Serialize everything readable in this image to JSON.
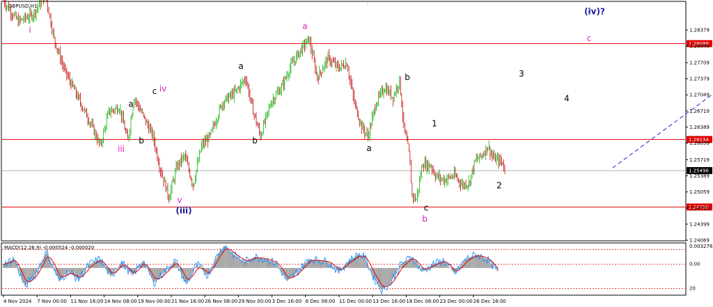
{
  "chart_data": {
    "type": "candlestick",
    "symbol_label": "GBPUSD,H1",
    "colors": {
      "bull": "#00b000",
      "bear": "#c00000",
      "hline": "#e00000",
      "wave_dark": "#000000",
      "wave_pink": "#e020c0",
      "wave_blue": "#1a1a9a",
      "macd_hist": "#a8a8a8",
      "macd_signal": "#e00000",
      "macd_line": "#1e90ff",
      "current_line": "#b0b0b0",
      "projection": "#2020d0"
    },
    "price_axis": {
      "min": 1.2407,
      "max": 1.2895,
      "ticks": [
        "1.28379",
        "1.28049",
        "1.27709",
        "1.27379",
        "1.27049",
        "1.26719",
        "1.26389",
        "1.26059",
        "1.25719",
        "1.25389",
        "1.25059",
        "1.24729",
        "1.24399",
        "1.24069"
      ]
    },
    "time_axis": {
      "bars": 380,
      "labels": [
        {
          "text": "4 Nov 2024",
          "bar": 0
        },
        {
          "text": "7 Nov 00:00",
          "bar": 29
        },
        {
          "text": "11 Nov 16:00",
          "bar": 57
        },
        {
          "text": "14 Nov 08:00",
          "bar": 86
        },
        {
          "text": "19 Nov 00:00",
          "bar": 115
        },
        {
          "text": "21 Nov 16:00",
          "bar": 143
        },
        {
          "text": "26 Nov 08:00",
          "bar": 172
        },
        {
          "text": "29 Nov 00:00",
          "bar": 201
        },
        {
          "text": "3 Dec 16:00",
          "bar": 229
        },
        {
          "text": "6 Dec 08:00",
          "bar": 258
        },
        {
          "text": "11 Dec 00:00",
          "bar": 287
        },
        {
          "text": "13 Dec 16:00",
          "bar": 315
        },
        {
          "text": "18 Dec 08:00",
          "bar": 344
        },
        {
          "text": "23 Dec 00:00",
          "bar": 373
        },
        {
          "text": "26 Dec 16:00",
          "bar": 401
        }
      ]
    },
    "horizontal_lines": [
      {
        "price": 1.28099,
        "label": "1.28099"
      },
      {
        "price": 1.26134,
        "label": "1.26134"
      },
      {
        "price": 1.2475,
        "label": "1.24750"
      }
    ],
    "current_price": {
      "price": 1.25496,
      "label": "1.25496"
    },
    "price_path": [
      [
        0,
        1.2897
      ],
      [
        14,
        1.2855
      ],
      [
        28,
        1.287
      ],
      [
        40,
        1.291
      ],
      [
        48,
        1.282
      ],
      [
        58,
        1.2755
      ],
      [
        66,
        1.272
      ],
      [
        75,
        1.268
      ],
      [
        82,
        1.265
      ],
      [
        92,
        1.26
      ],
      [
        100,
        1.267
      ],
      [
        110,
        1.268
      ],
      [
        118,
        1.261
      ],
      [
        124,
        1.27
      ],
      [
        133,
        1.266
      ],
      [
        142,
        1.262
      ],
      [
        148,
        1.256
      ],
      [
        157,
        1.2495
      ],
      [
        165,
        1.256
      ],
      [
        172,
        1.258
      ],
      [
        180,
        1.252
      ],
      [
        188,
        1.26
      ],
      [
        196,
        1.262
      ],
      [
        208,
        1.269
      ],
      [
        220,
        1.271
      ],
      [
        230,
        1.274
      ],
      [
        236,
        1.268
      ],
      [
        244,
        1.262
      ],
      [
        254,
        1.269
      ],
      [
        264,
        1.272
      ],
      [
        272,
        1.276
      ],
      [
        280,
        1.279
      ],
      [
        290,
        1.282
      ],
      [
        298,
        1.274
      ],
      [
        308,
        1.278
      ],
      [
        318,
        1.276
      ],
      [
        326,
        1.277
      ],
      [
        333,
        1.269
      ],
      [
        340,
        1.264
      ],
      [
        346,
        1.262
      ],
      [
        354,
        1.269
      ],
      [
        362,
        1.272
      ],
      [
        370,
        1.27
      ],
      [
        376,
        1.2735
      ],
      [
        380,
        1.264
      ],
      [
        385,
        1.2585
      ],
      [
        388,
        1.25
      ],
      [
        392,
        1.249
      ],
      [
        398,
        1.2565
      ],
      [
        402,
        1.256
      ],
      [
        406,
        1.256
      ],
      [
        410,
        1.254
      ],
      [
        418,
        1.253
      ],
      [
        428,
        1.254
      ],
      [
        436,
        1.252
      ],
      [
        442,
        1.2525
      ],
      [
        448,
        1.257
      ],
      [
        454,
        1.258
      ],
      [
        460,
        1.26
      ],
      [
        465,
        1.2575
      ],
      [
        470,
        1.257
      ],
      [
        474,
        1.2566
      ],
      [
        476,
        1.2549
      ]
    ],
    "labels": [
      {
        "text": "i",
        "bar": 18,
        "price": 1.2832,
        "color": "wave_pink"
      },
      {
        "text": "iii",
        "bar": 70,
        "price": 1.2588,
        "color": "wave_pink"
      },
      {
        "text": "iv",
        "bar": 93,
        "price": 1.2712,
        "color": "wave_pink"
      },
      {
        "text": "v",
        "bar": 104,
        "price": 1.2483,
        "color": "wave_pink"
      },
      {
        "text": "(iii)",
        "bar": 106,
        "price": 1.2462,
        "color": "wave_blue"
      },
      {
        "text": "a",
        "bar": 75,
        "price": 1.268,
        "color": "wave_dark"
      },
      {
        "text": "b",
        "bar": 81,
        "price": 1.2605,
        "color": "wave_dark"
      },
      {
        "text": "c",
        "bar": 89,
        "price": 1.2707,
        "color": "wave_dark"
      },
      {
        "text": "a",
        "bar": 139,
        "price": 1.2758,
        "color": "wave_dark"
      },
      {
        "text": "b",
        "bar": 147,
        "price": 1.2605,
        "color": "wave_dark"
      },
      {
        "text": "a",
        "bar": 176,
        "price": 1.284,
        "color": "wave_pink"
      },
      {
        "text": "a",
        "bar": 213,
        "price": 1.259,
        "color": "wave_dark"
      },
      {
        "text": "b",
        "bar": 235,
        "price": 1.2735,
        "color": "wave_dark"
      },
      {
        "text": "1",
        "bar": 251,
        "price": 1.264,
        "color": "wave_dark"
      },
      {
        "text": "c",
        "bar": 246,
        "price": 1.2468,
        "color": "wave_dark"
      },
      {
        "text": "b",
        "bar": 245,
        "price": 1.2445,
        "color": "wave_pink"
      },
      {
        "text": "2",
        "bar": 289,
        "price": 1.2513,
        "color": "wave_dark"
      },
      {
        "text": "3",
        "bar": 301,
        "price": 1.2742,
        "color": "wave_dark"
      },
      {
        "text": "4",
        "bar": 328,
        "price": 1.2692,
        "color": "wave_dark"
      },
      {
        "text": "c",
        "bar": 340,
        "price": 1.2815,
        "color": "wave_pink"
      },
      {
        "text": "(iv)?",
        "bar": 339,
        "price": 1.287,
        "color": "wave_blue"
      }
    ],
    "projection": {
      "from": [
        294,
        1.2555
      ],
      "to": [
        337,
        1.282
      ]
    },
    "macd": {
      "title": "MACD(12,26,9) -0.000524 -0.000020",
      "axis": {
        "min": -0.0036,
        "max": 0.0033,
        "ticks": [
          "0.003276",
          "0.00",
          "20"
        ]
      },
      "levels": [
        0.0025,
        0.0005,
        -0.0028
      ],
      "path": [
        [
          0,
          0.0005
        ],
        [
          10,
          0.0012
        ],
        [
          20,
          -0.0025
        ],
        [
          30,
          -0.0008
        ],
        [
          40,
          0.0022
        ],
        [
          52,
          -0.0018
        ],
        [
          60,
          -0.0005
        ],
        [
          70,
          -0.0015
        ],
        [
          80,
          0.0005
        ],
        [
          90,
          0.0012
        ],
        [
          100,
          -0.0012
        ],
        [
          110,
          0.0008
        ],
        [
          120,
          -0.001
        ],
        [
          130,
          0.001
        ],
        [
          140,
          -0.002
        ],
        [
          150,
          -0.0005
        ],
        [
          160,
          0.001
        ],
        [
          170,
          -0.0022
        ],
        [
          180,
          0.0005
        ],
        [
          190,
          -0.001
        ],
        [
          200,
          0.002
        ],
        [
          206,
          0.003
        ],
        [
          214,
          0.0018
        ],
        [
          224,
          0.0008
        ],
        [
          234,
          0.0015
        ],
        [
          244,
          0.0012
        ],
        [
          254,
          0.0006
        ],
        [
          264,
          -0.0018
        ],
        [
          274,
          -0.0005
        ],
        [
          284,
          0.0012
        ],
        [
          294,
          0.001
        ],
        [
          302,
          0.0008
        ],
        [
          312,
          -0.0005
        ],
        [
          320,
          0.0008
        ],
        [
          330,
          0.0018
        ],
        [
          336,
          0.0015
        ],
        [
          344,
          -0.0012
        ],
        [
          352,
          -0.003
        ],
        [
          360,
          -0.002
        ],
        [
          370,
          0.0005
        ],
        [
          380,
          0.0015
        ],
        [
          390,
          -0.0005
        ],
        [
          400,
          0.0005
        ],
        [
          410,
          0.001
        ],
        [
          420,
          -0.0008
        ],
        [
          430,
          0.0012
        ],
        [
          440,
          0.0018
        ],
        [
          450,
          0.0012
        ],
        [
          460,
          -0.0005
        ]
      ]
    }
  }
}
